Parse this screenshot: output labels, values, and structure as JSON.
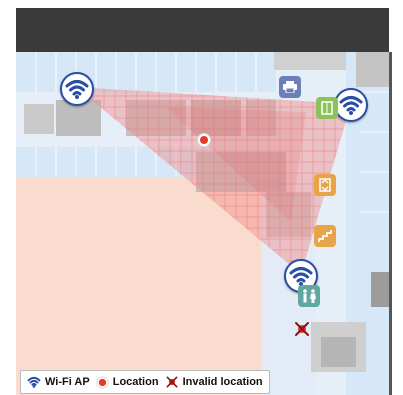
{
  "legend": {
    "wifi_label": "Wi-Fi AP",
    "location_label": "Location",
    "invalid_label": "Invalid location"
  },
  "colors": {
    "header": "#3a3a3a",
    "wifi_blue": "#2a4ea6",
    "location_red": "#e23b2a",
    "coverage_pink": "#f08a8a",
    "floor_peach": "#f9dccd",
    "corridor_blue": "#d6e8f7",
    "room_gray": "#c9c9c9"
  },
  "icons": {
    "wifi": "wifi-icon",
    "location": "location-dot-icon",
    "invalid": "invalid-location-icon",
    "printer": "printer-icon",
    "elevator": "elevator-icon",
    "stairs": "stairs-icon",
    "restroom": "restroom-icon"
  }
}
